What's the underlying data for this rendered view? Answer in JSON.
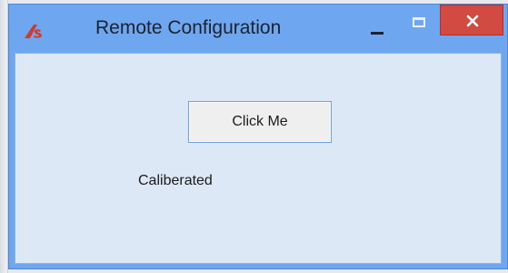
{
  "window": {
    "title": "Remote Configuration",
    "app_icon": "red-s-logo-icon",
    "controls": {
      "minimize_icon": "minimize-icon",
      "maximize_icon": "maximize-icon",
      "close_icon": "close-icon"
    }
  },
  "content": {
    "button_label": "Click Me",
    "status_text": "Caliberated"
  },
  "colors": {
    "titlebar": "#6ea6f0",
    "client_bg": "#dde8f6",
    "close_button": "#d24a41",
    "button_border": "#6ea3e6",
    "logo": "#d23a2e"
  }
}
